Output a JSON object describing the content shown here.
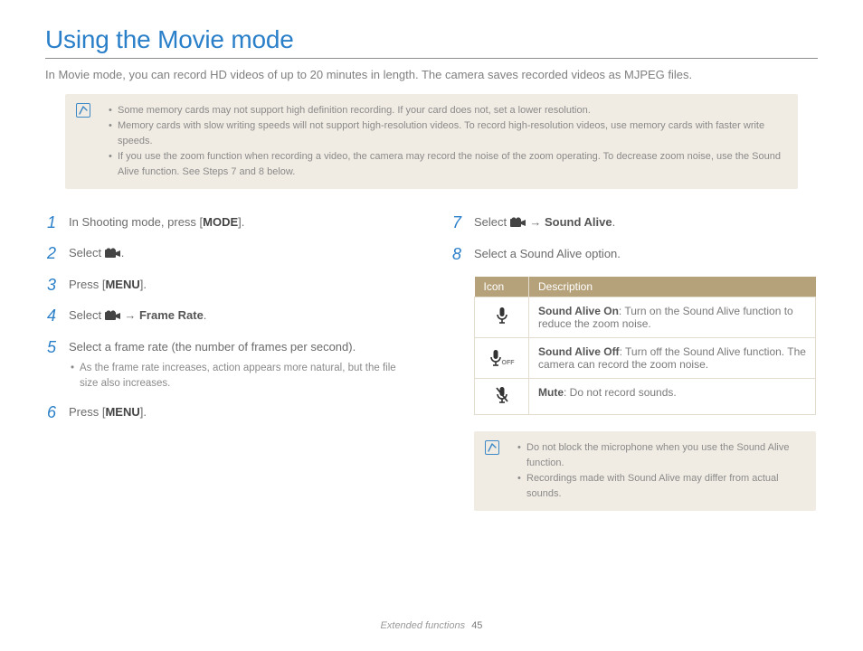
{
  "title": "Using the Movie mode",
  "intro": "In Movie mode, you can record HD videos of up to 20 minutes in length. The camera saves recorded videos as MJPEG files.",
  "top_notes": [
    "Some memory cards may not support high definition recording. If your card does not, set a lower resolution.",
    "Memory cards with slow writing speeds will not support high-resolution videos. To record high-resolution videos, use memory cards with faster write speeds.",
    "If you use the zoom function when recording a video, the camera may record the noise of the zoom operating. To decrease zoom noise, use the Sound Alive function. See Steps 7 and 8 below."
  ],
  "steps_left": {
    "s1_pre": "In Shooting mode, press [",
    "s1_btn": "MODE",
    "s1_post": "].",
    "s2_pre": "Select ",
    "s3_pre": "Press [",
    "s3_btn": "MENU",
    "s3_post": "].",
    "s4_pre": "Select ",
    "s4_arrow": " → ",
    "s4_bold": "Frame Rate",
    "s5": "Select a frame rate (the number of frames per second).",
    "s5_sub": "As the frame rate increases, action appears more natural, but the file size also increases.",
    "s6_pre": "Press [",
    "s6_btn": "MENU",
    "s6_post": "]."
  },
  "steps_right": {
    "s7_pre": "Select ",
    "s7_arrow": " → ",
    "s7_bold": "Sound Alive",
    "s8": "Select a Sound Alive option."
  },
  "table": {
    "h1": "Icon",
    "h2": "Description",
    "r1_bold": "Sound Alive On",
    "r1_rest": ": Turn on the Sound Alive function to reduce the zoom noise.",
    "r2_bold": "Sound Alive Off",
    "r2_rest": ": Turn off the Sound Alive function. The camera can record the zoom noise.",
    "r3_bold": "Mute",
    "r3_rest": ": Do not record sounds."
  },
  "bottom_notes": [
    "Do not block the microphone when you use the Sound Alive function.",
    "Recordings made with Sound Alive may differ from actual sounds."
  ],
  "footer_section": "Extended functions",
  "footer_page": "45",
  "icons": {
    "mic_off_sub": "OFF"
  }
}
